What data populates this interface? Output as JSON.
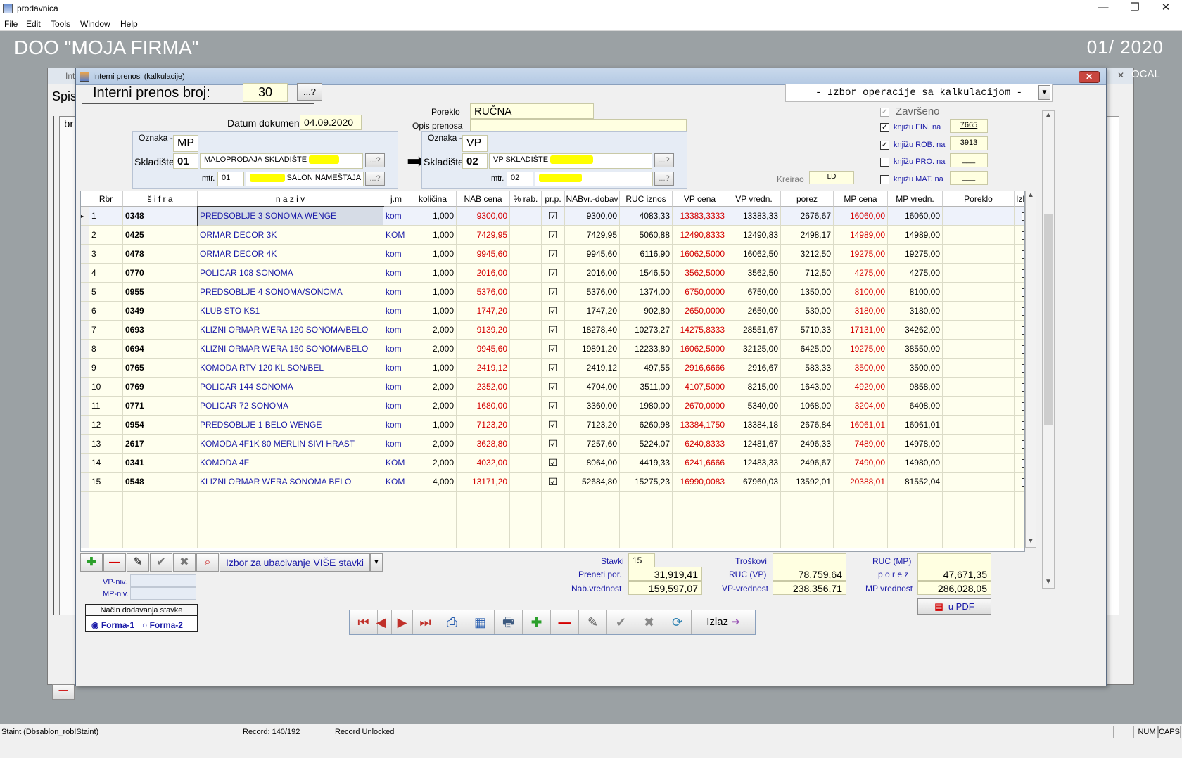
{
  "window": {
    "title": "prodavnica",
    "minimize": "—",
    "restore": "❐",
    "close": "✕"
  },
  "menu": [
    "File",
    "Edit",
    "Tools",
    "Window",
    "Help"
  ],
  "header": {
    "firm": "DOO  \"MOJA FIRMA\"",
    "period": "01/ 2020"
  },
  "bg_window": {
    "title": "Int",
    "label": "Spis",
    "col": "br",
    "ocal": "OCAL"
  },
  "dialog": {
    "title": "Interni prenosi (kalkulacije)",
    "close": "✕",
    "doc_label": "Interni prenos broj:",
    "doc_number": "30",
    "lookup": "...?",
    "operation_select": "- Izbor operacije sa kalkulacijom -",
    "date_label": "Datum dokumenta",
    "date_value": "04.09.2020",
    "poreklo_label": "Poreklo",
    "poreklo_value": "RUČNA",
    "opis_label": "Opis prenosa",
    "opis_value": "",
    "zavrseno_label": "Završeno",
    "kreirao_label": "Kreirao",
    "kreirao_value": "LD",
    "fin_label": "knjižu FIN. na",
    "fin_value": "7665",
    "rob_label": "knjižu ROB. na",
    "rob_value": "3913",
    "pro_label": "knjižu PRO. na",
    "pro_value": "___",
    "mat_label": "knjižu MAT. na",
    "mat_value": "___",
    "from": {
      "oznaka_label": "Oznaka -cene-",
      "oznaka_value": "MP",
      "skladiste_label": "Skladište",
      "skladiste_code": "01",
      "skladiste_name": "MALOPRODAJA SKLADIŠTE",
      "mtr_label": "mtr.",
      "mtr_code": "01",
      "mtr_name": "SALON NAMEŠTAJA"
    },
    "to": {
      "oznaka_label": "Oznaka -cene-",
      "oznaka_value": "VP",
      "skladiste_label": "Skladište",
      "skladiste_code": "02",
      "skladiste_name": "VP SKLADIŠTE",
      "mtr_label": "mtr.",
      "mtr_code": "02",
      "mtr_name": ""
    },
    "arrow": "➡"
  },
  "table": {
    "headers": [
      "Rbr",
      "š i f r a",
      "n a z i v",
      "j.m",
      "količina",
      "NAB cena",
      "% rab.",
      "pr.p.",
      "NABvr.-dobav",
      "RUC iznos",
      "VP cena",
      "VP vredn.",
      "porez",
      "MP cena",
      "MP vredn.",
      "Poreklo",
      "Izbor"
    ],
    "rows": [
      [
        "1",
        "0348",
        "PREDSOBLJE 3 SONOMA WENGE",
        "kom",
        "1,000",
        "9300,00",
        "",
        "☑",
        "9300,00",
        "4083,33",
        "13383,3333",
        "13383,33",
        "2676,67",
        "16060,00",
        "16060,00",
        "",
        ""
      ],
      [
        "2",
        "0425",
        "ORMAR DECOR 3K",
        "KOM",
        "1,000",
        "7429,95",
        "",
        "☑",
        "7429,95",
        "5060,88",
        "12490,8333",
        "12490,83",
        "2498,17",
        "14989,00",
        "14989,00",
        "",
        ""
      ],
      [
        "3",
        "0478",
        "ORMAR DECOR 4K",
        "kom",
        "1,000",
        "9945,60",
        "",
        "☑",
        "9945,60",
        "6116,90",
        "16062,5000",
        "16062,50",
        "3212,50",
        "19275,00",
        "19275,00",
        "",
        ""
      ],
      [
        "4",
        "0770",
        "POLICAR 108 SONOMA",
        "kom",
        "1,000",
        "2016,00",
        "",
        "☑",
        "2016,00",
        "1546,50",
        "3562,5000",
        "3562,50",
        "712,50",
        "4275,00",
        "4275,00",
        "",
        ""
      ],
      [
        "5",
        "0955",
        "PREDSOBLJE 4 SONOMA/SONOMA",
        "kom",
        "1,000",
        "5376,00",
        "",
        "☑",
        "5376,00",
        "1374,00",
        "6750,0000",
        "6750,00",
        "1350,00",
        "8100,00",
        "8100,00",
        "",
        ""
      ],
      [
        "6",
        "0349",
        "KLUB STO KS1",
        "kom",
        "1,000",
        "1747,20",
        "",
        "☑",
        "1747,20",
        "902,80",
        "2650,0000",
        "2650,00",
        "530,00",
        "3180,00",
        "3180,00",
        "",
        ""
      ],
      [
        "7",
        "0693",
        "KLIZNI ORMAR WERA 120 SONOMA/BELO",
        "kom",
        "2,000",
        "9139,20",
        "",
        "☑",
        "18278,40",
        "10273,27",
        "14275,8333",
        "28551,67",
        "5710,33",
        "17131,00",
        "34262,00",
        "",
        ""
      ],
      [
        "8",
        "0694",
        "KLIZNI ORMAR WERA 150 SONOMA/BELO",
        "kom",
        "2,000",
        "9945,60",
        "",
        "☑",
        "19891,20",
        "12233,80",
        "16062,5000",
        "32125,00",
        "6425,00",
        "19275,00",
        "38550,00",
        "",
        ""
      ],
      [
        "9",
        "0765",
        "KOMODA RTV 120 KL SON/BEL",
        "kom",
        "1,000",
        "2419,12",
        "",
        "☑",
        "2419,12",
        "497,55",
        "2916,6666",
        "2916,67",
        "583,33",
        "3500,00",
        "3500,00",
        "",
        ""
      ],
      [
        "10",
        "0769",
        "POLICAR 144 SONOMA",
        "kom",
        "2,000",
        "2352,00",
        "",
        "☑",
        "4704,00",
        "3511,00",
        "4107,5000",
        "8215,00",
        "1643,00",
        "4929,00",
        "9858,00",
        "",
        ""
      ],
      [
        "11",
        "0771",
        "POLICAR 72 SONOMA",
        "kom",
        "2,000",
        "1680,00",
        "",
        "☑",
        "3360,00",
        "1980,00",
        "2670,0000",
        "5340,00",
        "1068,00",
        "3204,00",
        "6408,00",
        "",
        ""
      ],
      [
        "12",
        "0954",
        "PREDSOBLJE 1 BELO WENGE",
        "kom",
        "1,000",
        "7123,20",
        "",
        "☑",
        "7123,20",
        "6260,98",
        "13384,1750",
        "13384,18",
        "2676,84",
        "16061,01",
        "16061,01",
        "",
        ""
      ],
      [
        "13",
        "2617",
        "KOMODA 4F1K 80 MERLIN SIVI HRAST",
        "kom",
        "2,000",
        "3628,80",
        "",
        "☑",
        "7257,60",
        "5224,07",
        "6240,8333",
        "12481,67",
        "2496,33",
        "7489,00",
        "14978,00",
        "",
        ""
      ],
      [
        "14",
        "0341",
        "KOMODA 4F",
        "KOM",
        "2,000",
        "4032,00",
        "",
        "☑",
        "8064,00",
        "4419,33",
        "6241,6666",
        "12483,33",
        "2496,67",
        "7490,00",
        "14980,00",
        "",
        ""
      ],
      [
        "15",
        "0548",
        "KLIZNI ORMAR WERA SONOMA BELO",
        "KOM",
        "4,000",
        "13171,20",
        "",
        "☑",
        "52684,80",
        "15275,23",
        "16990,0083",
        "67960,03",
        "13592,01",
        "20388,01",
        "81552,04",
        "",
        ""
      ]
    ]
  },
  "toolbar": {
    "multi_label": "Izbor za ubacivanje VIŠE stavki"
  },
  "left_info": {
    "vp_label": "VP-niv.",
    "mp_label": "MP-niv.",
    "nacin_label": "Način dodavanja stavke",
    "forma1": "Forma-1",
    "forma2": "Forma-2"
  },
  "totals": {
    "stavki_label": "Stavki",
    "stavki_value": "15",
    "preneti_label": "Preneti por.",
    "preneti_value": "31,919,41",
    "nab_label": "Nab.vrednost",
    "nab_value": "159,597,07",
    "troskovi_label": "Troškovi",
    "troskovi_value": "",
    "rucvp_label": "RUC  (VP)",
    "rucvp_value": "78,759,64",
    "vpvr_label": "VP-vrednost",
    "vpvr_value": "238,356,71",
    "rucmp_label": "RUC  (MP)",
    "rucmp_value": "",
    "porez_label": "p o r e z",
    "porez_value": "47,671,35",
    "mpvr_label": "MP vrednost",
    "mpvr_value": "286,028,05",
    "pdf_label": "u  PDF"
  },
  "nav": {
    "izlaz": "Izlaz"
  },
  "status": {
    "left": "Staint (Dbsablon_rob!Staint)",
    "record": "Record: 140/192",
    "lock": "Record Unlocked",
    "num": "NUM",
    "caps": "CAPS"
  }
}
